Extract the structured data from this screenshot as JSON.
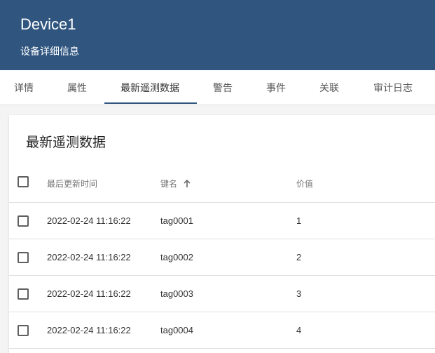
{
  "header": {
    "title": "Device1",
    "subtitle": "设备详细信息"
  },
  "tabs": [
    {
      "label": "详情"
    },
    {
      "label": "属性"
    },
    {
      "label": "最新遥测数据"
    },
    {
      "label": "警告"
    },
    {
      "label": "事件"
    },
    {
      "label": "关联"
    },
    {
      "label": "审计日志"
    }
  ],
  "active_tab_index": 2,
  "card": {
    "title": "最新遥测数据",
    "columns": {
      "time": "最后更新时间",
      "key": "键名",
      "value": "价值"
    },
    "sort": {
      "column": "key",
      "direction": "ascending",
      "icon": "arrow-up-icon"
    },
    "rows": [
      {
        "time": "2022-02-24 11:16:22",
        "key": "tag0001",
        "value": "1"
      },
      {
        "time": "2022-02-24 11:16:22",
        "key": "tag0002",
        "value": "2"
      },
      {
        "time": "2022-02-24 11:16:22",
        "key": "tag0003",
        "value": "3"
      },
      {
        "time": "2022-02-24 11:16:22",
        "key": "tag0004",
        "value": "4"
      }
    ]
  },
  "colors": {
    "header_bg": "#305680",
    "accent": "#305680"
  }
}
